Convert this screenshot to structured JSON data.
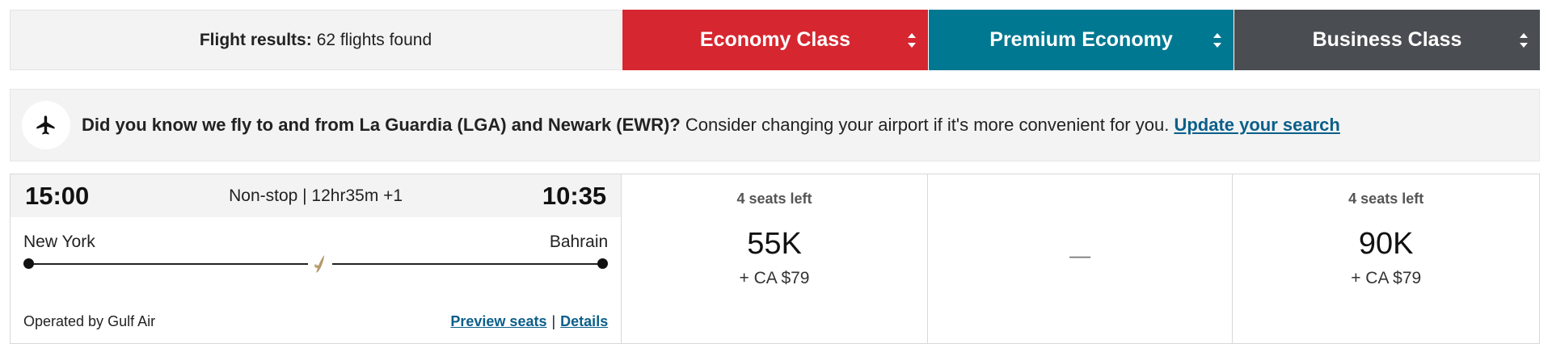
{
  "header": {
    "results_label": "Flight results:",
    "results_count": "62 flights found",
    "tabs": [
      {
        "label": "Economy Class",
        "color": "#d6262f"
      },
      {
        "label": "Premium Economy",
        "color": "#007891"
      },
      {
        "label": "Business Class",
        "color": "#4a4d51"
      }
    ]
  },
  "banner": {
    "icon": "plane-icon",
    "bold_text": "Did you know we fly to and from La Guardia (LGA) and Newark (EWR)?",
    "text": " Consider changing your airport if it's more convenient for you. ",
    "link": "Update your search"
  },
  "flight": {
    "depart_time": "15:00",
    "duration": "Non-stop | 12hr35m +1",
    "arrive_time": "10:35",
    "origin": "New York",
    "destination": "Bahrain",
    "operated_by": "Operated by Gulf Air",
    "preview_seats": "Preview seats",
    "separator": "|",
    "details": "Details",
    "fares": {
      "economy": {
        "seats": "4 seats left",
        "points": "55K",
        "tax": "+ CA $79"
      },
      "premium": {
        "unavailable": "—"
      },
      "business": {
        "seats": "4 seats left",
        "points": "90K",
        "tax": "+ CA $79"
      }
    }
  }
}
